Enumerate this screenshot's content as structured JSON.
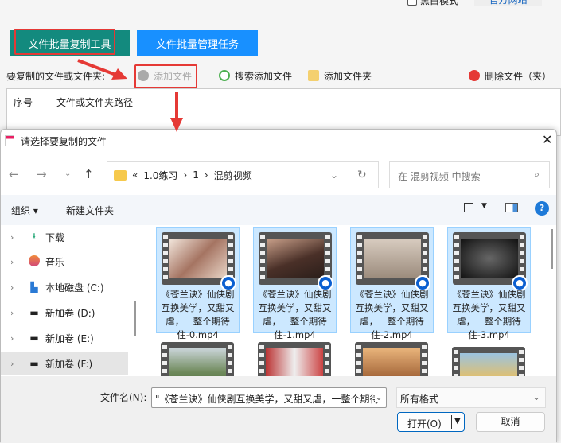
{
  "app": {
    "dark_mode_label": "黑白模式",
    "official_site_label": "官方网站",
    "tab_copy_tool": "文件批量复制工具",
    "tab_manage_tasks": "文件批量管理任务",
    "toolbar": {
      "label": "要复制的文件或文件夹:",
      "add_file": "添加文件",
      "search_add_file": "搜索添加文件",
      "add_folder": "添加文件夹",
      "delete": "删除文件（夹）"
    },
    "table": {
      "col_index": "序号",
      "col_path": "文件或文件夹路径"
    }
  },
  "dialog": {
    "title": "请选择要复制的文件",
    "breadcrumb": [
      "«",
      "1.0练习",
      "›",
      "1",
      "›",
      "混剪视频"
    ],
    "search_placeholder": "在 混剪视频 中搜索",
    "organize": "组织 ▾",
    "new_folder": "新建文件夹",
    "sidebar": [
      {
        "label": "下载",
        "icon": "download-icon"
      },
      {
        "label": "音乐",
        "icon": "music-icon"
      },
      {
        "label": "本地磁盘 (C:)",
        "icon": "drive-icon"
      },
      {
        "label": "新加卷 (D:)",
        "icon": "drive-icon"
      },
      {
        "label": "新加卷 (E:)",
        "icon": "drive-icon"
      },
      {
        "label": "新加卷 (F:)",
        "icon": "drive-icon",
        "selected": true
      }
    ],
    "files": [
      {
        "name": "《苍兰诀》仙侠剧互换美学，又甜又虐，一整个期待住-0.mp4",
        "selected": true
      },
      {
        "name": "《苍兰诀》仙侠剧互换美学，又甜又虐，一整个期待住-1.mp4",
        "selected": true
      },
      {
        "name": "《苍兰诀》仙侠剧互换美学，又甜又虐，一整个期待住-2.mp4",
        "selected": true
      },
      {
        "name": "《苍兰诀》仙侠剧互换美学，又甜又虐，一整个期待住-3.mp4",
        "selected": true
      }
    ],
    "filename_label": "文件名(N):",
    "filename_value": "\"《苍兰诀》仙侠剧互换美学，又甜又虐，一整个期待",
    "filter_value": "所有格式",
    "open_label": "打开(O)",
    "cancel_label": "取消"
  },
  "colors": {
    "teal": "#138a7e",
    "blue": "#1890ff",
    "red": "#e53935",
    "selection": "#cce8ff"
  }
}
